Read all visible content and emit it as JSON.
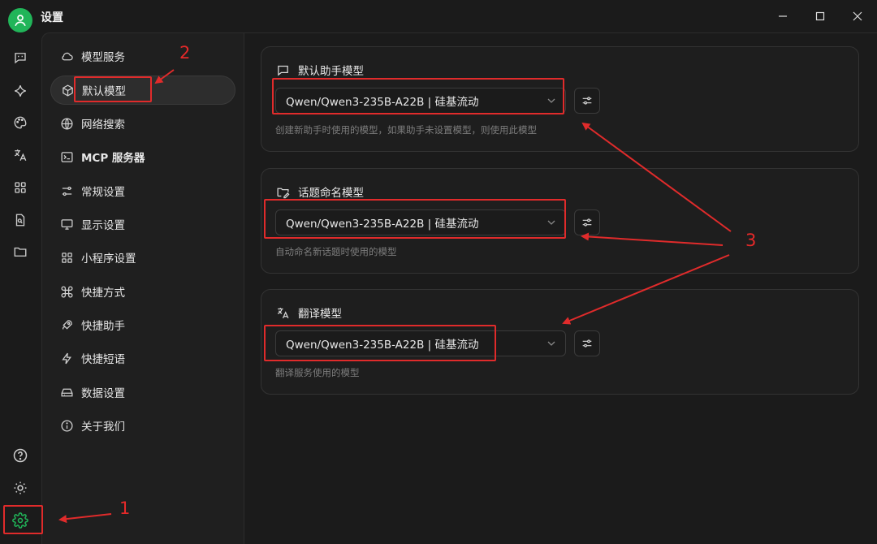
{
  "window": {
    "title": "设置"
  },
  "rail": {
    "top_icons": [
      "chat-icon",
      "sparkle-icon",
      "palette-icon",
      "translate-icon",
      "apps-grid-icon",
      "file-search-icon",
      "folder-icon"
    ],
    "bottom_icons": [
      "help-icon",
      "theme-toggle-icon",
      "settings-gear-icon"
    ]
  },
  "settings_nav": {
    "items": [
      {
        "label": "模型服务",
        "icon": "cloud-icon"
      },
      {
        "label": "默认模型",
        "icon": "cube-icon",
        "active": true
      },
      {
        "label": "网络搜索",
        "icon": "globe-icon"
      },
      {
        "label": "MCP 服务器",
        "icon": "terminal-icon"
      },
      {
        "label": "常规设置",
        "icon": "sliders-icon"
      },
      {
        "label": "显示设置",
        "icon": "monitor-icon"
      },
      {
        "label": "小程序设置",
        "icon": "grid-icon"
      },
      {
        "label": "快捷方式",
        "icon": "command-icon"
      },
      {
        "label": "快捷助手",
        "icon": "rocket-icon"
      },
      {
        "label": "快捷短语",
        "icon": "zap-icon"
      },
      {
        "label": "数据设置",
        "icon": "hard-drive-icon"
      },
      {
        "label": "关于我们",
        "icon": "info-icon"
      }
    ]
  },
  "model_cards": [
    {
      "title": "默认助手模型",
      "icon": "message-square-icon",
      "selected": "Qwen/Qwen3-235B-A22B | 硅基流动",
      "description": "创建新助手时使用的模型，如果助手未设置模型，则使用此模型"
    },
    {
      "title": "话题命名模型",
      "icon": "folder-pen-icon",
      "selected": "Qwen/Qwen3-235B-A22B | 硅基流动",
      "description": "自动命名新话题时使用的模型"
    },
    {
      "title": "翻译模型",
      "icon": "translate-icon",
      "selected": "Qwen/Qwen3-235B-A22B | 硅基流动",
      "description": "翻译服务使用的模型"
    }
  ],
  "annotations": {
    "one": "1",
    "two": "2",
    "three": "3"
  },
  "colors": {
    "accent_green": "#21b559",
    "annotation_red": "#e02b2b",
    "background": "#1b1b1b"
  }
}
